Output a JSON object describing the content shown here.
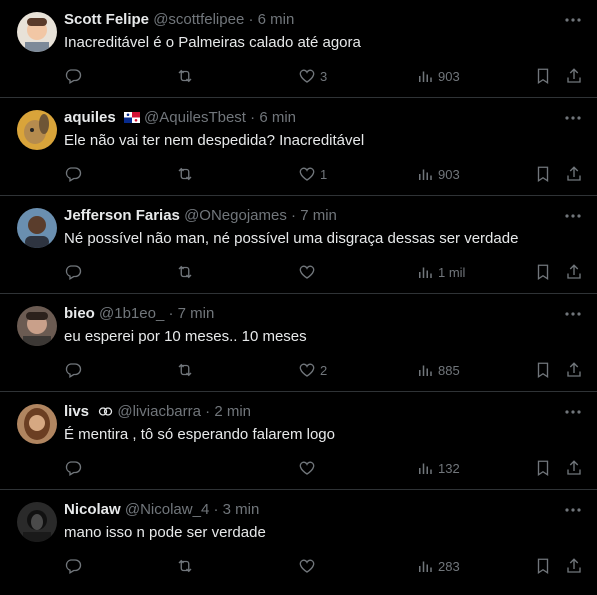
{
  "posts": [
    {
      "name": "Scott Felipe",
      "handle": "@scottfelipee",
      "time": "6 min",
      "text": "Inacreditável é o Palmeiras calado até agora",
      "replies": "",
      "reposts": "",
      "likes": "3",
      "views": "903",
      "avatar_color": "#e8e2d8"
    },
    {
      "name": "aquiles",
      "handle": "@AquilesTbest",
      "time": "6 min",
      "text": "Ele não vai ter nem despedida? Inacreditável",
      "replies": "",
      "reposts": "",
      "likes": "1",
      "views": "903",
      "avatar_color": "#d9a43a",
      "flag": "panama-flag-icon"
    },
    {
      "name": "Jefferson Farias",
      "handle": "@ONegojames",
      "time": "7 min",
      "text": "Né possível não man, né possível uma disgraça dessas ser verdade",
      "replies": "",
      "reposts": "",
      "likes": "",
      "views": "1 mil",
      "avatar_color": "#6a8fb0"
    },
    {
      "name": "bieo",
      "handle": "@1b1eo_",
      "time": "7 min",
      "text": "eu esperei por 10 meses.. 10 meses",
      "replies": "",
      "reposts": "",
      "likes": "2",
      "views": "885",
      "avatar_color": "#6b5b52"
    },
    {
      "name": "livs",
      "handle": "@liviacbarra",
      "time": "2 min",
      "text": "É mentira , tô só esperando falarem logo",
      "replies": "",
      "reposts": "",
      "likes": "",
      "views": "132",
      "avatar_color": "#b08560"
    },
    {
      "name": "Nicolaw",
      "handle": "@Nicolaw_4",
      "time": "3 min",
      "text": "mano isso n pode ser verdade",
      "replies": "",
      "reposts": "",
      "likes": "",
      "views": "283",
      "avatar_color": "#2a2a2a"
    }
  ],
  "colors": {
    "background": "#000000",
    "text": "#e7e9ea",
    "muted": "#71767b",
    "divider": "#2f3336"
  },
  "icons": [
    "reply-icon",
    "repost-icon",
    "like-icon",
    "views-icon",
    "bookmark-icon",
    "share-icon",
    "more-icon"
  ],
  "separator": "·"
}
